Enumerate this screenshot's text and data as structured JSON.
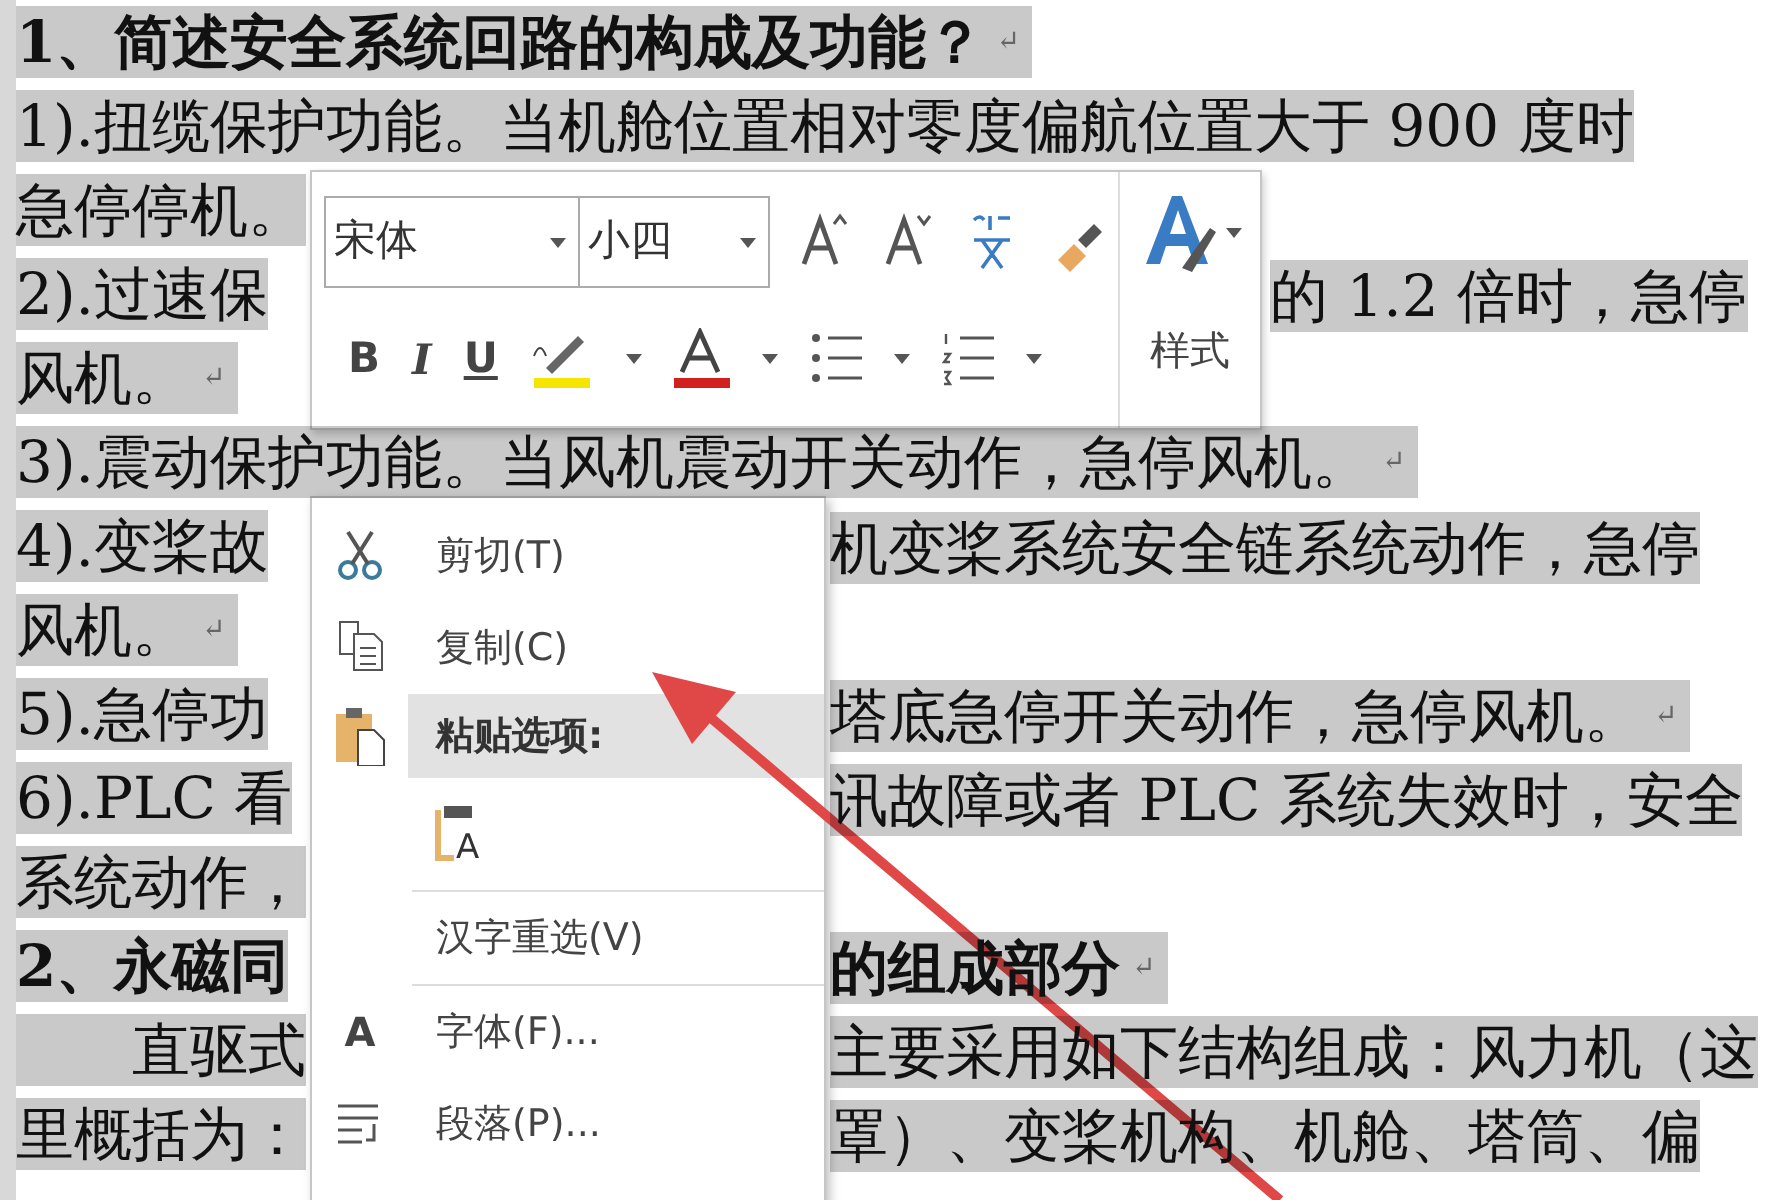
{
  "document": {
    "lines": [
      {
        "segments": [
          {
            "text": "1、简述安全系统回路的构成及功能？",
            "bold": true
          }
        ],
        "end_mark": "↵"
      },
      {
        "segments": [
          {
            "text": "1).扭缆保护功能。当机舱位置相对零度偏航位置大于 900 度时",
            "bold": false
          }
        ]
      },
      {
        "segments": [
          {
            "text": "急停停机。",
            "bold": false
          }
        ]
      },
      {
        "segments": [
          {
            "text": "2).过速保",
            "bold": false
          },
          {
            "text": "的 1.2 倍时，急停",
            "bold": false
          }
        ]
      },
      {
        "segments": [
          {
            "text": "风机。",
            "bold": false
          }
        ],
        "end_mark": "↵"
      },
      {
        "segments": [
          {
            "text": "3).震动保护功能。当风机震动开关动作，急停风机。",
            "bold": false
          }
        ],
        "end_mark": "↵"
      },
      {
        "segments": [
          {
            "text": "4).变桨故",
            "bold": false
          },
          {
            "text": "机变桨系统安全链系统动作，急停",
            "bold": false
          }
        ]
      },
      {
        "segments": [
          {
            "text": "风机。",
            "bold": false
          }
        ],
        "end_mark": "↵"
      },
      {
        "segments": [
          {
            "text": "5).急停功",
            "bold": false
          },
          {
            "text": "塔底急停开关动作，急停风机。",
            "bold": false
          }
        ],
        "end_mark": "↵"
      },
      {
        "segments": [
          {
            "text": "6).PLC 看",
            "bold": false
          },
          {
            "text": "讯故障或者 PLC 系统失效时，安全",
            "bold": false
          }
        ]
      },
      {
        "segments": [
          {
            "text": "系统动作，",
            "bold": false
          }
        ]
      },
      {
        "segments": [
          {
            "text": "2、永磁同",
            "bold": true
          },
          {
            "text": "的组成部分",
            "bold": true
          }
        ],
        "end_mark": "↵"
      },
      {
        "segments": [
          {
            "text": "　　直驱式",
            "bold": false
          },
          {
            "text": "主要采用如下结构组成：风力机（这",
            "bold": false
          }
        ]
      },
      {
        "segments": [
          {
            "text": "里概括为：",
            "bold": false
          },
          {
            "text": "罩）、变桨机构、机舱、塔筒、偏",
            "bold": false
          }
        ]
      }
    ]
  },
  "mini_toolbar": {
    "font_name": "宋体",
    "font_size": "小四",
    "bold_button": "B",
    "italic_button": "I",
    "underline_button": "U",
    "styles_label": "样式"
  },
  "context_menu": {
    "items": [
      {
        "kind": "item",
        "label": "剪切(T)"
      },
      {
        "kind": "item",
        "label": "复制(C)"
      },
      {
        "kind": "header",
        "label": "粘贴选项:"
      },
      {
        "kind": "paste_option",
        "icon_letter": "A"
      },
      {
        "kind": "separator"
      },
      {
        "kind": "item",
        "label": "汉字重选(V)"
      },
      {
        "kind": "separator"
      },
      {
        "kind": "item",
        "label": "字体(F)...",
        "icon_letter": "A"
      },
      {
        "kind": "item",
        "label": "段落(P)..."
      }
    ]
  }
}
